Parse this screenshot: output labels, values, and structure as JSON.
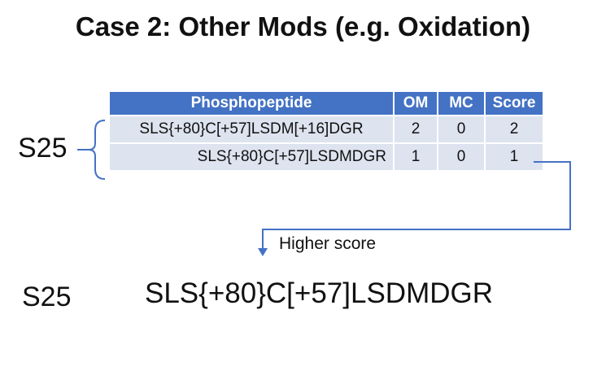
{
  "title": "Case 2: Other Mods (e.g. Oxidation)",
  "table": {
    "headers": [
      "Phosphopeptide",
      "OM",
      "MC",
      "Score"
    ],
    "rows": [
      {
        "peptide": "SLS{+80}C[+57]LSDM[+16]DGR",
        "om": "2",
        "mc": "0",
        "score": "2"
      },
      {
        "peptide": "SLS{+80}C[+57]LSDMDGR",
        "om": "1",
        "mc": "0",
        "score": "1"
      }
    ]
  },
  "group_site": "S25",
  "arrow_label": "Higher score",
  "result": {
    "site": "S25",
    "peptide": "SLS{+80}C[+57]LSDMDGR"
  },
  "colors": {
    "header_bg": "#4472c4",
    "cell_bg": "#dde3ef",
    "connector": "#4472c4"
  }
}
